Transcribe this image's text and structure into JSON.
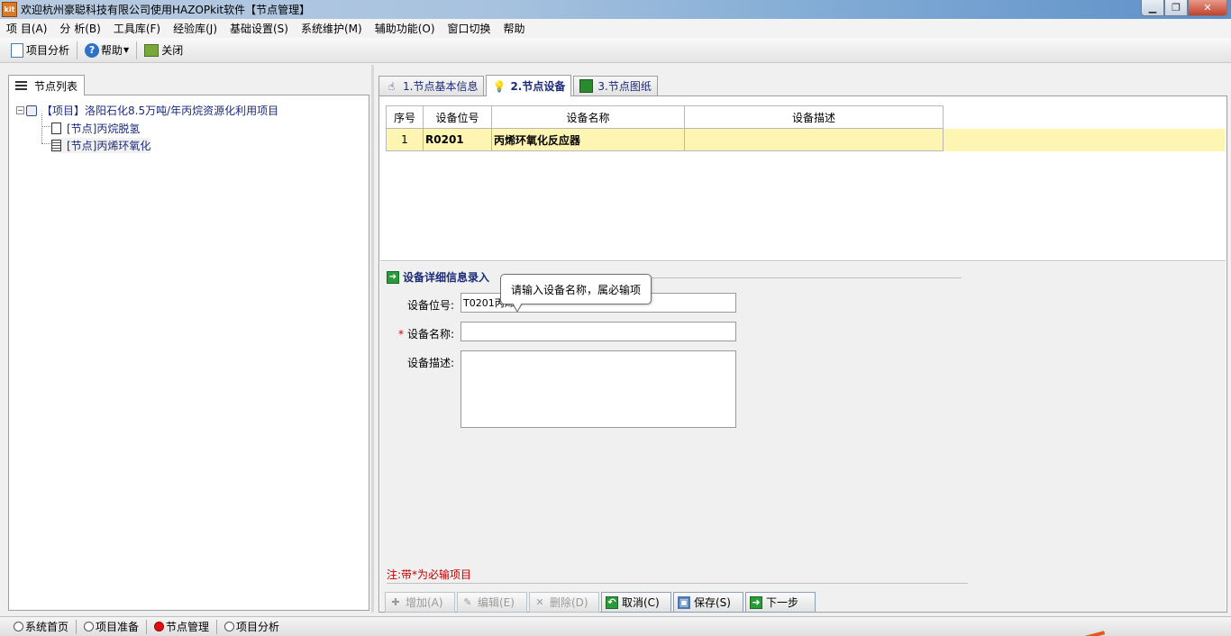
{
  "window": {
    "title": "欢迎杭州豪聪科技有限公司使用HAZOPkit软件【节点管理】",
    "app_icon_text": "kit"
  },
  "menu": [
    "项 目(A)",
    "分 析(B)",
    "工具库(F)",
    "经验库(J)",
    "基础设置(S)",
    "系统维护(M)",
    "辅助功能(O)",
    "窗口切换",
    "帮助"
  ],
  "toolbar": {
    "project_analysis": "项目分析",
    "help": "帮助",
    "close": "关闭"
  },
  "left_panel": {
    "tab_label": "节点列表",
    "tree": {
      "project": "【项目】洛阳石化8.5万吨/年丙烷资源化利用项目",
      "nodes": [
        "[节点]丙烷脱氢",
        "[节点]丙烯环氧化"
      ]
    }
  },
  "tabs": [
    "1.节点基本信息",
    "2.节点设备",
    "3.节点图纸"
  ],
  "grid": {
    "columns": [
      "序号",
      "设备位号",
      "设备名称",
      "设备描述"
    ],
    "rows": [
      {
        "no": "1",
        "tag": "R0201",
        "name": "丙烯环氧化反应器",
        "desc": ""
      }
    ]
  },
  "form": {
    "section_title": "设备详细信息录入",
    "tag_label": "设备位号:",
    "tag_value": "T0201丙烯",
    "name_label": "设备名称:",
    "name_value": "",
    "desc_label": "设备描述:",
    "desc_value": "",
    "required_mark": "*",
    "tooltip": "请输入设备名称，属必输项",
    "note": "注:带*为必输项目"
  },
  "actions": {
    "add": "增加(A)",
    "edit": "编辑(E)",
    "delete": "删除(D)",
    "cancel": "取消(C)",
    "save": "保存(S)",
    "next": "下一步"
  },
  "statusbar": {
    "items": [
      "系统首页",
      "项目准备",
      "节点管理",
      "项目分析"
    ],
    "active_index": 2
  },
  "colors": {
    "selected_row": "#fff5b3",
    "required": "#d00000",
    "title_text": "#1c2a7a"
  }
}
